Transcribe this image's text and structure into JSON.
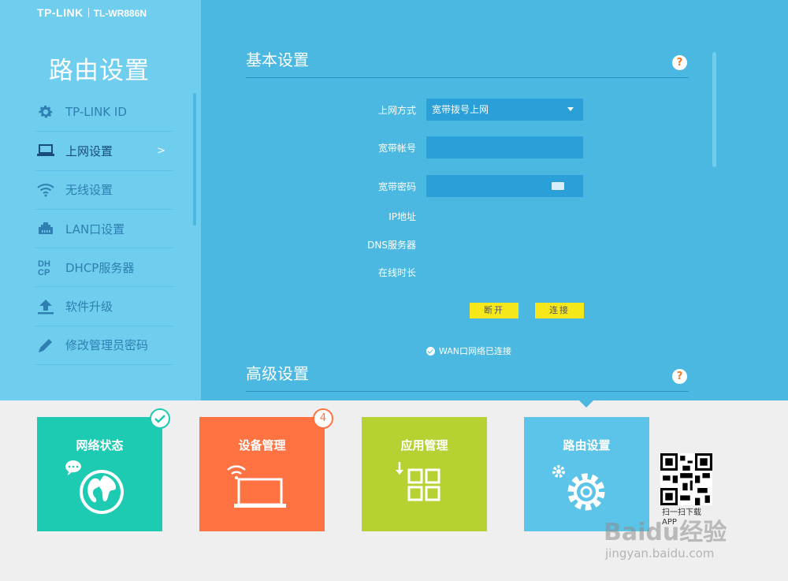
{
  "header": {
    "brand": "TP-LINK",
    "model": "TL-WR886N"
  },
  "sidebar": {
    "title": "路由设置",
    "items": [
      {
        "label": "TP-LINK ID",
        "icon": "gear-icon"
      },
      {
        "label": "上网设置",
        "icon": "laptop-icon",
        "active": true,
        "chevron": ">"
      },
      {
        "label": "无线设置",
        "icon": "wifi-icon"
      },
      {
        "label": "LAN口设置",
        "icon": "ethernet-port-icon"
      },
      {
        "label": "DHCP服务器",
        "icon": "dhcp-icon"
      },
      {
        "label": "软件升级",
        "icon": "upload-icon"
      },
      {
        "label": "修改管理员密码",
        "icon": "pencil-icon"
      }
    ]
  },
  "basic": {
    "title": "基本设置",
    "help": "?",
    "fields": {
      "wan_mode_label": "上网方式",
      "wan_mode_value": "宽带拨号上网",
      "account_label": "宽带帐号",
      "password_label": "宽带密码",
      "ip_label": "IP地址",
      "dns_label": "DNS服务器",
      "uptime_label": "在线时长"
    },
    "disconnect_button": "断开",
    "connect_button": "连接",
    "status_text": "WAN口网络已连接"
  },
  "advanced": {
    "title": "高级设置",
    "help": "?"
  },
  "tiles": [
    {
      "label": "网络状态",
      "icon": "globe-chat-icon"
    },
    {
      "label": "设备管理",
      "icon": "laptop-wifi-icon",
      "badge": "4"
    },
    {
      "label": "应用管理",
      "icon": "apps-grid-icon"
    },
    {
      "label": "路由设置",
      "icon": "gears-icon"
    }
  ],
  "qr": {
    "caption": "扫一扫下载APP"
  },
  "watermark": {
    "main": "Baidu经验",
    "sub": "jingyan.baidu.com"
  },
  "colors": {
    "top_bg": "#4ab8e0",
    "sidebar_bg": "#6fcdee",
    "tile_network": "#1dcab2",
    "tile_device": "#ff7343",
    "tile_app": "#b5d132",
    "tile_router": "#5bc4e8",
    "button": "#f6e71a"
  }
}
